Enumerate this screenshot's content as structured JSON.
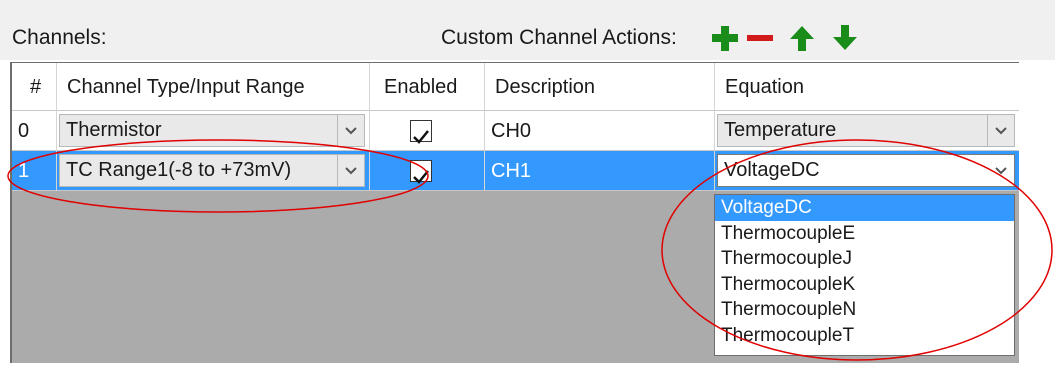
{
  "header": {
    "channels_label": "Channels:",
    "actions_label": "Custom Channel Actions:",
    "actions": [
      {
        "name": "add",
        "icon": "plus-icon",
        "color": "#1a8c1a"
      },
      {
        "name": "remove",
        "icon": "minus-icon",
        "color": "#d11a1a"
      },
      {
        "name": "move-up",
        "icon": "arrow-up-icon",
        "color": "#1a8c1a"
      },
      {
        "name": "move-down",
        "icon": "arrow-down-icon",
        "color": "#1a8c1a"
      }
    ]
  },
  "table": {
    "columns": [
      "#",
      "Channel Type/Input Range",
      "Enabled",
      "Description",
      "Equation"
    ],
    "rows": [
      {
        "index": "0",
        "channel_type": "Thermistor",
        "enabled": true,
        "description": "CH0",
        "equation": "Temperature",
        "selected": false
      },
      {
        "index": "1",
        "channel_type": "TC Range1(-8 to +73mV)",
        "enabled": true,
        "description": "CH1",
        "equation": "VoltageDC",
        "selected": true
      }
    ]
  },
  "equation_dropdown": {
    "selected": "VoltageDC",
    "options": [
      "VoltageDC",
      "ThermocoupleE",
      "ThermocoupleJ",
      "ThermocoupleK",
      "ThermocoupleN",
      "ThermocoupleT"
    ]
  },
  "colors": {
    "selection": "#3399ff",
    "annotation": "#e00000",
    "grid_background": "#ababab"
  }
}
